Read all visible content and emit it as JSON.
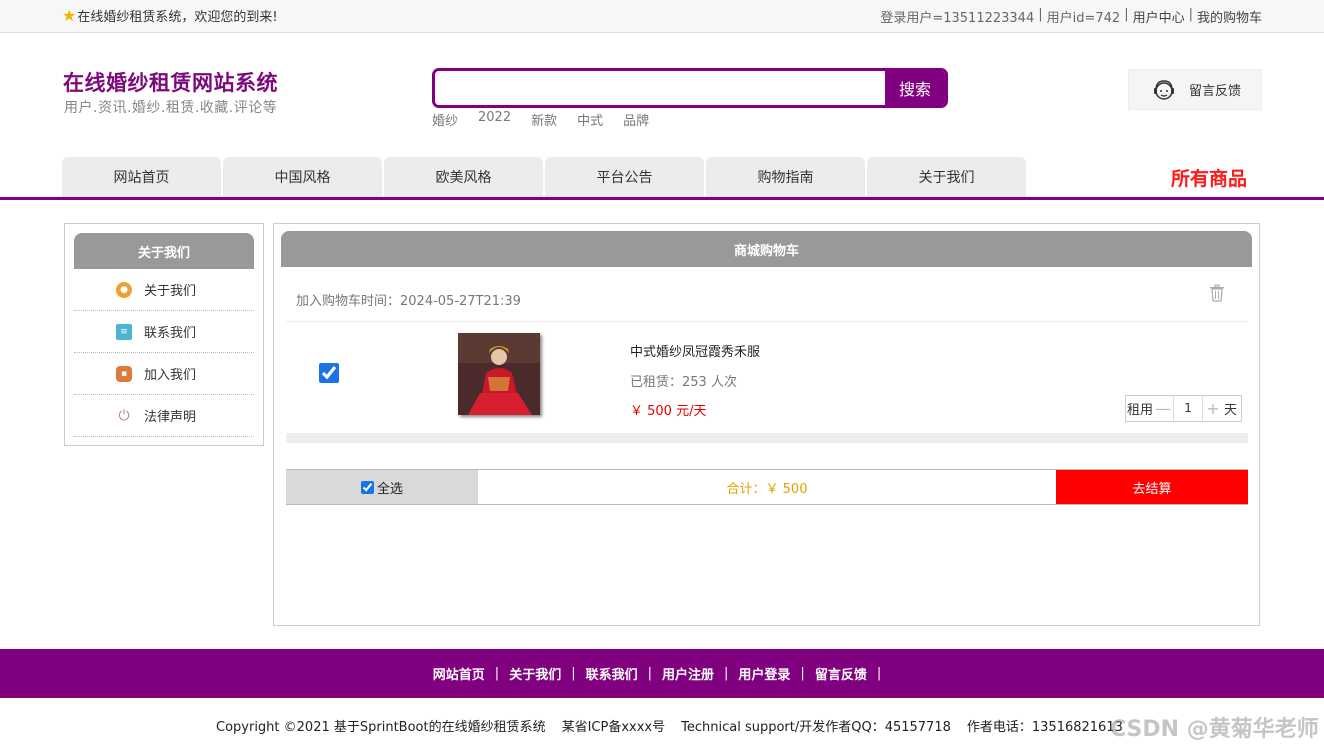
{
  "topbar": {
    "welcome": "在线婚纱租赁系统，欢迎您的到来!",
    "login_user": "登录用户=13511223344",
    "user_id": "用户id=742",
    "user_center": "用户中心",
    "my_cart": "我的购物车",
    "separator": "|"
  },
  "header": {
    "title": "在线婚纱租赁网站系统",
    "subtitle": "用户.资讯.婚纱.租赁.收藏.评论等",
    "search": {
      "placeholder": "",
      "value": "",
      "button": "搜索"
    },
    "hotwords": [
      "婚纱",
      "2022",
      "新款",
      "中式",
      "品牌"
    ],
    "feedback": "留言反馈"
  },
  "nav": {
    "tabs": [
      "网站首页",
      "中国风格",
      "欧美风格",
      "平台公告",
      "购物指南",
      "关于我们"
    ],
    "all_products": "所有商品"
  },
  "sidebar": {
    "title": "关于我们",
    "items": [
      {
        "label": "关于我们",
        "icon": "info-circle-icon",
        "color": "#f0a030"
      },
      {
        "label": "联系我们",
        "icon": "clipboard-icon",
        "color": "#4ab5d0"
      },
      {
        "label": "加入我们",
        "icon": "lock-icon",
        "color": "#e07a3a"
      },
      {
        "label": "法律声明",
        "icon": "power-icon",
        "color": "#c08080"
      }
    ]
  },
  "cart": {
    "title": "商城购物车",
    "added_time": "加入购物车时间：2024-05-27T21:39",
    "item": {
      "checked": true,
      "name": "中式婚纱凤冠霞秀禾服",
      "rented": "已租赁：253 人次",
      "price": "￥ 500 元/天",
      "qty_label": "租用",
      "qty_value": "1",
      "qty_unit": "天"
    },
    "select_all": "全选",
    "total": "合计：￥ 500",
    "checkout": "去结算"
  },
  "footer": {
    "links": [
      "网站首页",
      "关于我们",
      "联系我们",
      "用户注册",
      "用户登录",
      "留言反馈"
    ],
    "separator": "|",
    "copyright": "Copyright ©2021 基于SprintBoot的在线婚纱租赁系统",
    "icp": "某省ICP备xxxx号",
    "support": "Technical support/开发作者QQ：45157718",
    "phone": "作者电话：13516821613",
    "watermark": "CSDN @黄菊华老师"
  },
  "colors": {
    "brand_purple": "#800080",
    "accent_red": "#ff0000",
    "total_orange": "#e6a100"
  }
}
